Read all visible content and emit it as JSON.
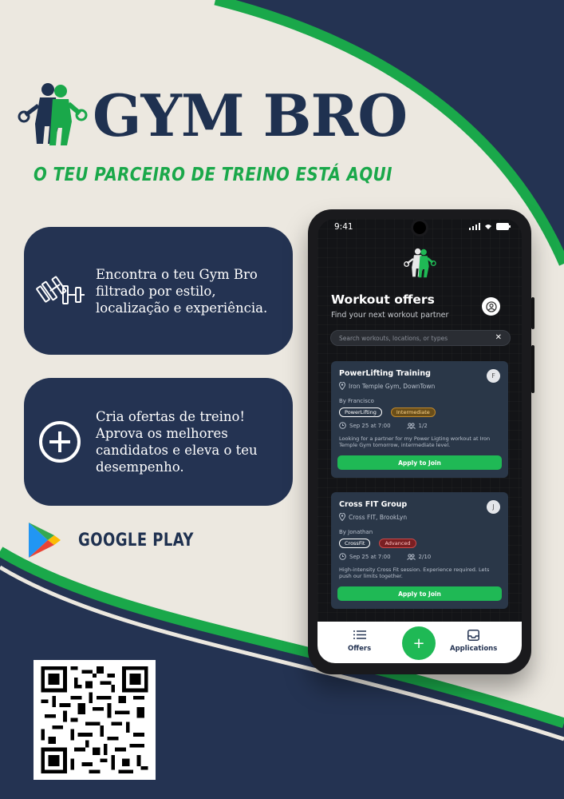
{
  "brand": {
    "name": "GYM BRO",
    "tagline": "O TEU PARCEIRO DE TREINO ESTÁ AQUI"
  },
  "features": [
    {
      "icon": "dumbbell-icon",
      "text": "Encontra o teu Gym Bro filtrado por estilo, localização e experiência."
    },
    {
      "icon": "plus-circle-icon",
      "text": "Cria ofertas de treino! Aprova os melhores candidatos e eleva o teu desempenho."
    }
  ],
  "store": {
    "icon": "google-play-icon",
    "label": "GOOGLE PLAY"
  },
  "phone": {
    "status_time": "9:41",
    "title": "Workout offers",
    "subtitle": "Find your next workout partner",
    "search_placeholder": "Search workouts, locations, or types",
    "offers": [
      {
        "title": "PowerLifting Training",
        "location": "Iron Temple Gym, DownTown",
        "author": "By Francisco",
        "initial": "F",
        "tags": [
          "PowerLifting",
          "Intermediate"
        ],
        "datetime": "Sep 25 at 7:00",
        "participants": "1/2",
        "description": "Looking for a partner for my Power Ligting workout at Iron Temple Gym tomorrow, intermediate level.",
        "button": "Apply to Join"
      },
      {
        "title": "Cross FIT Group",
        "location": "Cross FIT, BrookLyn",
        "author": "By Jonathan",
        "initial": "J",
        "tags": [
          "CrossFit",
          "Advanced"
        ],
        "datetime": "Sep 25 at 7:00",
        "participants": "2/10",
        "description": "High-intensity Cross Fit session. Experience required. Lets push our limits together.",
        "button": "Apply to Join"
      }
    ],
    "tabs": {
      "offers": "Offers",
      "applications": "Applications",
      "fab": "+"
    }
  },
  "colors": {
    "navy": "#243352",
    "green": "#1aa84a",
    "cream": "#ece8e0"
  }
}
